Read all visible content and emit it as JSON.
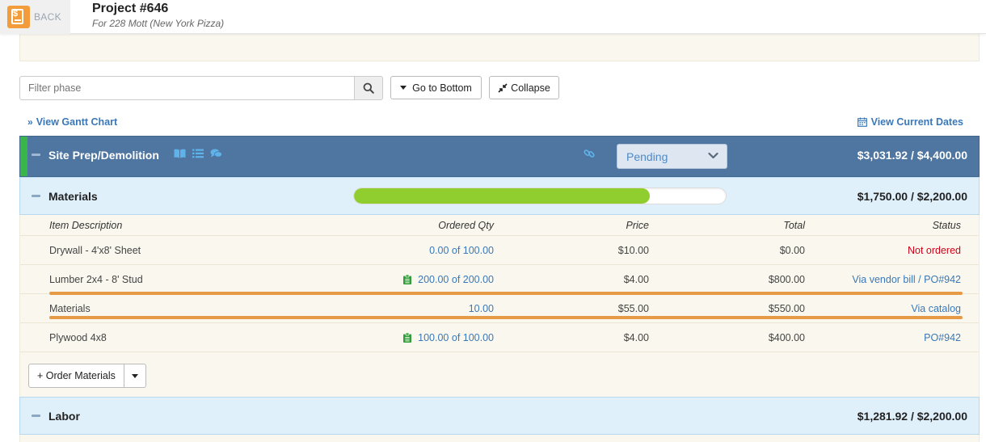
{
  "header": {
    "back_label": "BACK",
    "project_title": "Project #646",
    "project_subtitle": "For 228 Mott (New York Pizza)"
  },
  "toolbar": {
    "filter_placeholder": "Filter phase",
    "go_to_bottom_label": "Go to Bottom",
    "collapse_label": "Collapse"
  },
  "links": {
    "gantt": "View Gantt Chart",
    "current_dates": "View Current Dates"
  },
  "phase": {
    "title": "Site Prep/Demolition",
    "status": "Pending",
    "total": "$3,031.92 / $4,400.00",
    "accent_color": "#4f76a1",
    "status_stripe_color": "#39b54a"
  },
  "materials": {
    "title": "Materials",
    "total": "$1,750.00 / $2,200.00",
    "progress_fraction": 0.795,
    "columns": {
      "description": "Item Description",
      "ordered_qty": "Ordered Qty",
      "price": "Price",
      "total": "Total",
      "status": "Status"
    },
    "rows": [
      {
        "description": "Drywall - 4'x8' Sheet",
        "qty": "0.00 of 100.00",
        "price": "$10.00",
        "total": "$0.00",
        "status": "Not ordered",
        "status_color": "#d0021b",
        "clipboard": false
      },
      {
        "description": "Lumber 2x4 - 8' Stud",
        "qty": "200.00 of 200.00",
        "price": "$4.00",
        "total": "$800.00",
        "status": "Via vendor bill / PO#942",
        "status_color": "#3a78b8",
        "clipboard": true
      },
      {
        "description": "Materials",
        "qty": "10.00",
        "price": "$55.00",
        "total": "$550.00",
        "status": "Via catalog",
        "status_color": "#3a78b8",
        "clipboard": false
      },
      {
        "description": "Plywood 4x8",
        "qty": "100.00 of 100.00",
        "price": "$4.00",
        "total": "$400.00",
        "status": "PO#942",
        "status_color": "#3a78b8",
        "clipboard": true
      }
    ],
    "order_button_label": "+ Order Materials"
  },
  "labor": {
    "title": "Labor",
    "total": "$1,281.92 / $2,200.00"
  }
}
